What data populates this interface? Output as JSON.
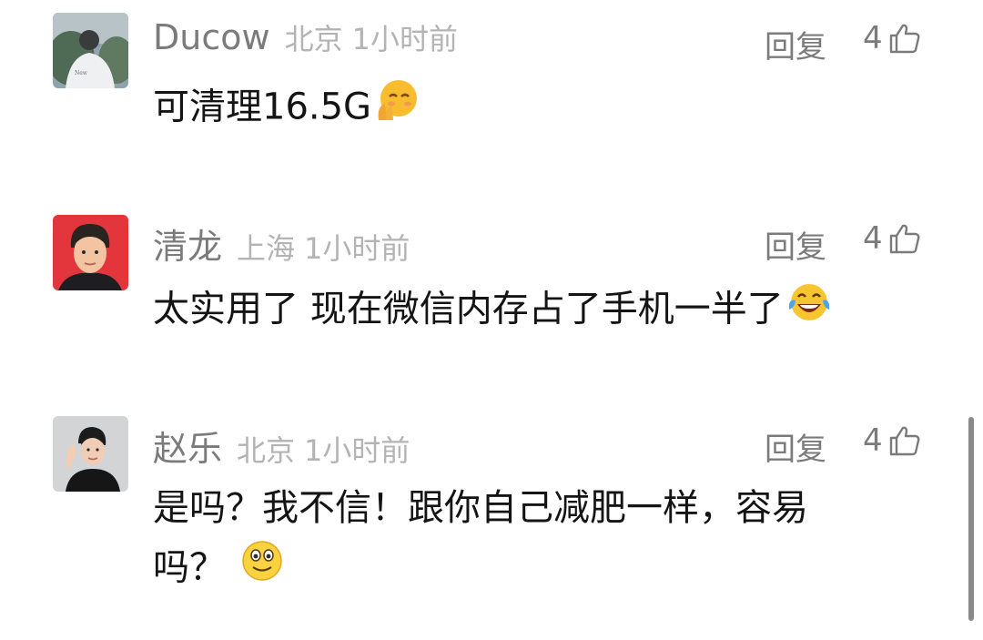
{
  "comments": [
    {
      "username": "Ducow",
      "location": "北京",
      "time": "1小时前",
      "reply_label": "回复",
      "likes": "4",
      "text": "可清理16.5G",
      "emoji": "shy-smile-emoji"
    },
    {
      "username": "清龙",
      "location": "上海",
      "time": "1小时前",
      "reply_label": "回复",
      "likes": "4",
      "text": "太实用了 现在微信内存占了手机一半了",
      "emoji": "laugh-tears-emoji"
    },
    {
      "username": "赵乐",
      "location": "北京",
      "time": "1小时前",
      "reply_label": "回复",
      "likes": "4",
      "text_line1": "是吗？我不信！跟你自己减肥一样，容易",
      "text_line2": "吗？",
      "emoji": "smile-emoji"
    }
  ],
  "colors": {
    "username": "#7b7b7b",
    "meta": "#b4b4b4",
    "text": "#141414",
    "reply": "#7b7b7b"
  }
}
